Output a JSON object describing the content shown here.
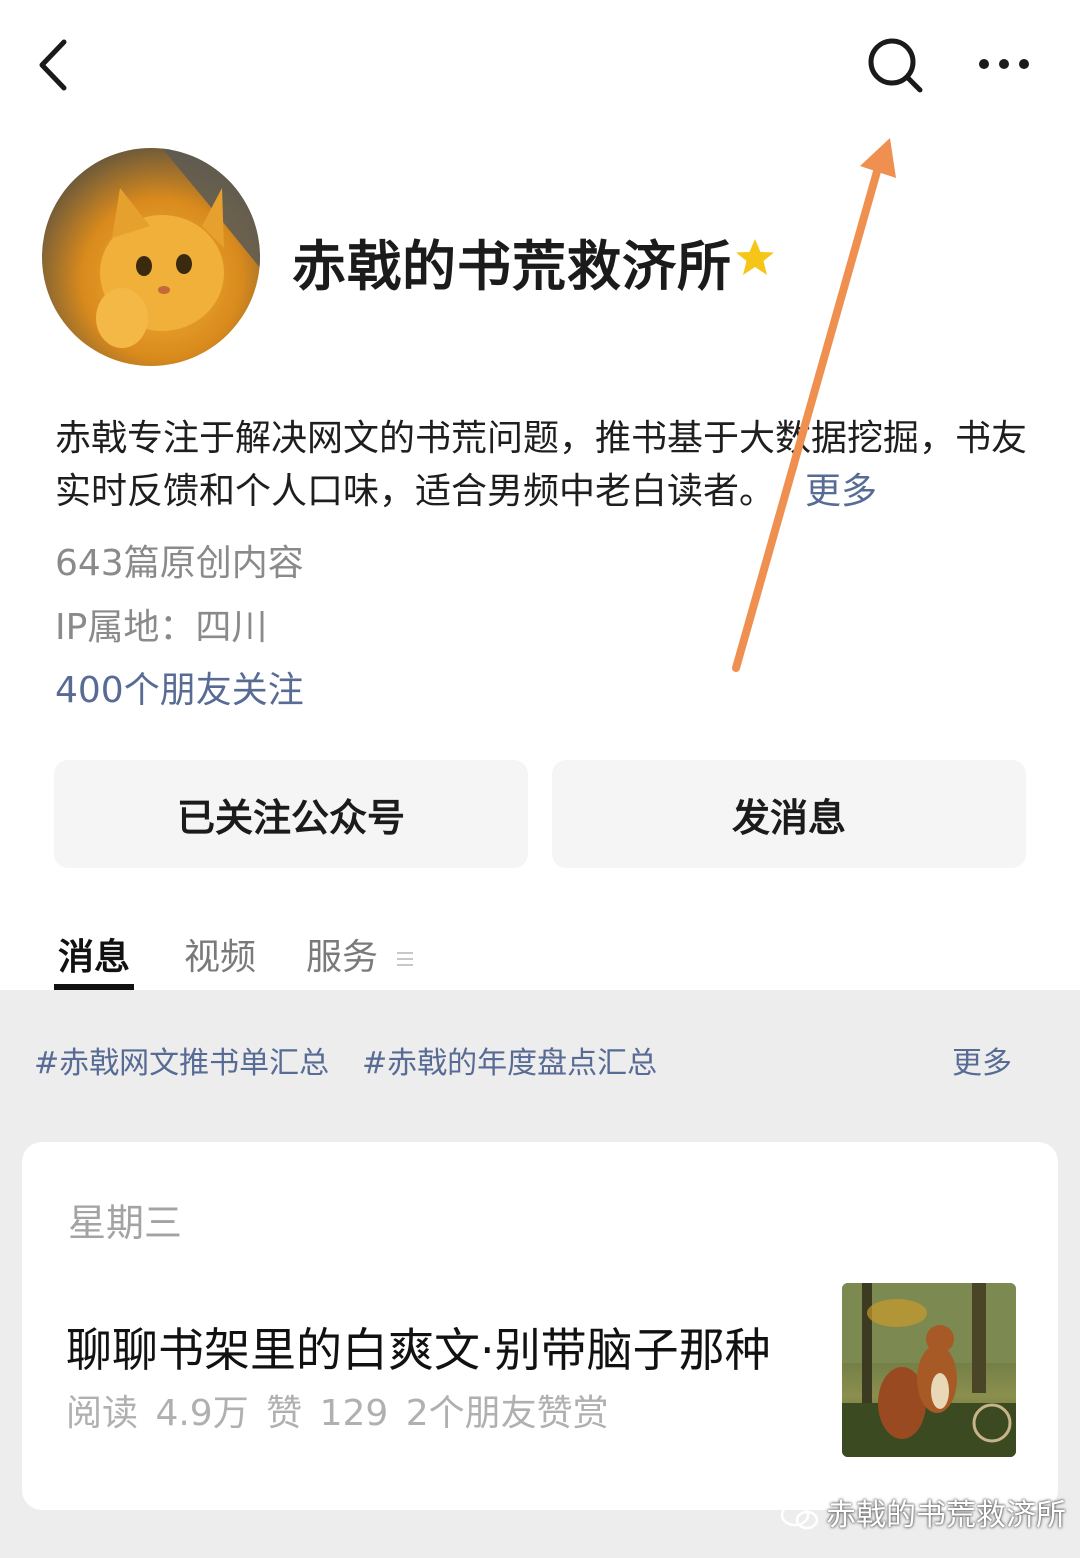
{
  "profile": {
    "name": "赤戟的书荒救济所",
    "description": "赤戟专注于解决网文的书荒问题，推书基于大数据挖掘，书友实时反馈和个人口味，适合男频中老白读者。",
    "description_more": "更多",
    "articles": "643篇原创内容",
    "ip_location": "IP属地：四川",
    "friends_following": "400个朋友关注"
  },
  "actions": {
    "follow_label": "已关注公众号",
    "message_label": "发消息"
  },
  "tabs": [
    {
      "label": "消息",
      "active": true
    },
    {
      "label": "视频",
      "active": false
    },
    {
      "label": "服务",
      "active": false
    }
  ],
  "tags": {
    "items": [
      "#赤戟网文推书单汇总",
      "#赤戟的年度盘点汇总"
    ],
    "more": "更多"
  },
  "feed": {
    "day": "星期三",
    "article": {
      "title": "聊聊书架里的白爽文·别带脑子那种",
      "meta": "阅读 4.9万   赞 129   2个朋友赞赏"
    }
  },
  "watermark": "赤戟的书荒救济所",
  "colors": {
    "link": "#576b95",
    "annotation_arrow": "#ef9050",
    "star": "#f5c518"
  },
  "icons": [
    "back-icon",
    "search-icon",
    "more-icon",
    "star-icon",
    "wechat-icon"
  ]
}
